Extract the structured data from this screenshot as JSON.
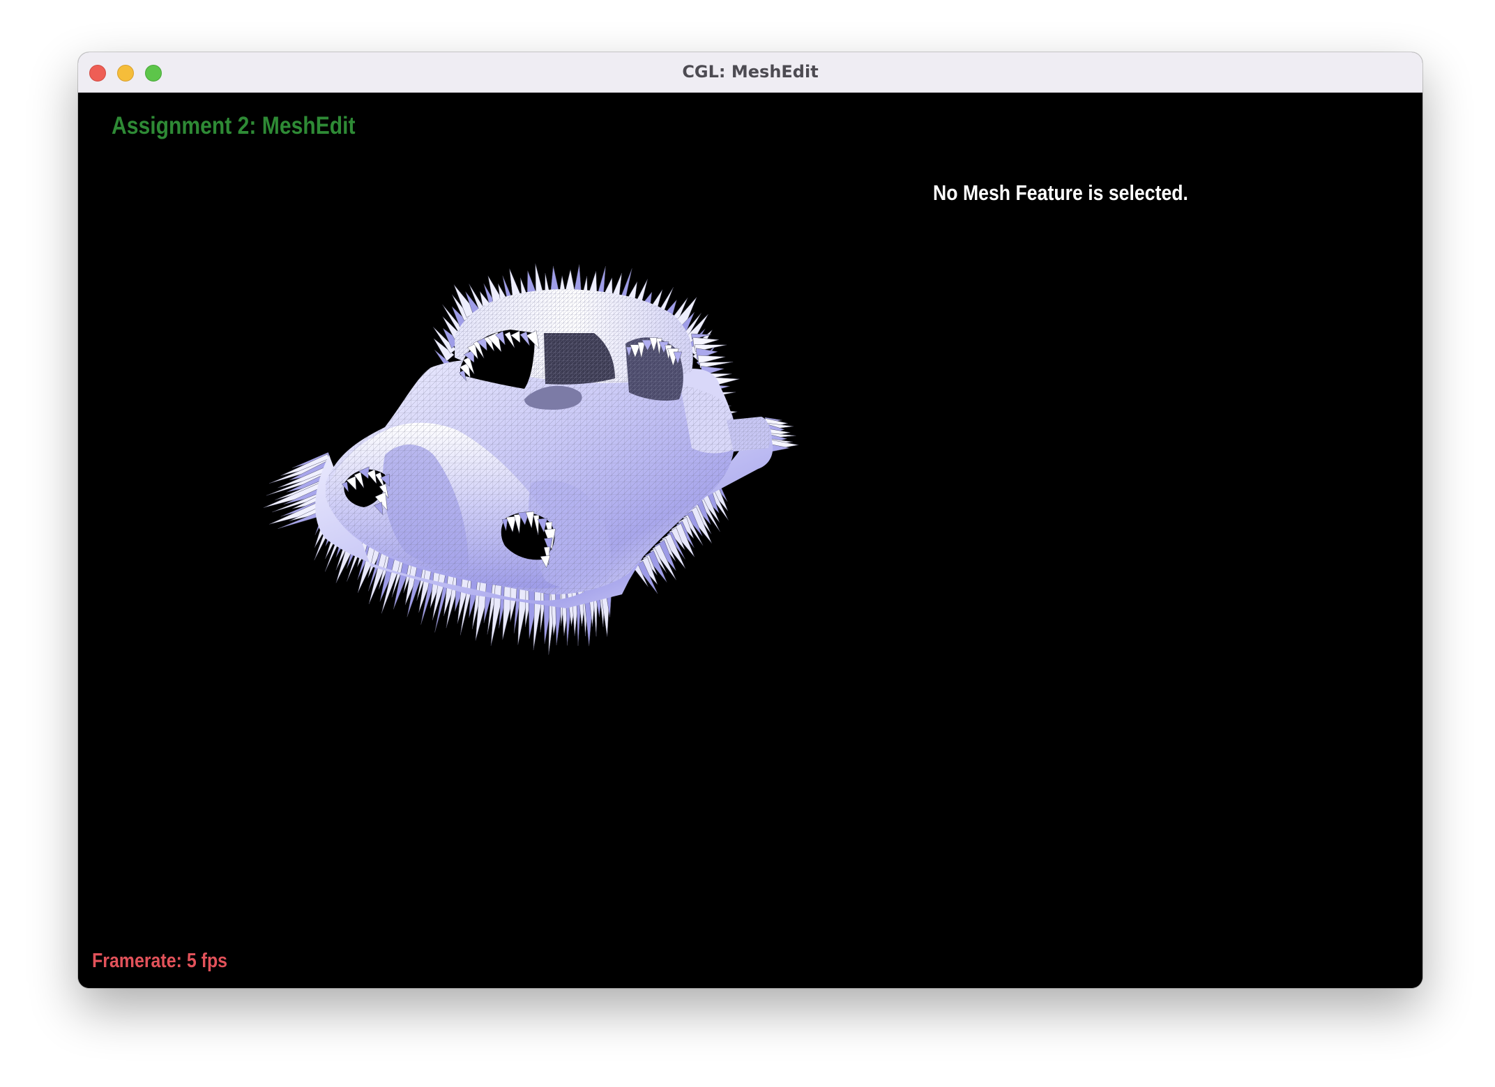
{
  "window": {
    "title": "CGL: MeshEdit"
  },
  "viewport": {
    "overlay_title": "Assignment 2: MeshEdit",
    "selection_status": "No Mesh Feature is selected.",
    "framerate": "Framerate: 5 fps",
    "model": "car mesh with vertex normals / spikes, flat-shaded lavender wireframe"
  },
  "colors": {
    "title_green": "#2e8a35",
    "framerate_red": "#e2525a",
    "mesh_lavender": "#b9b8f0",
    "background": "#000000"
  }
}
